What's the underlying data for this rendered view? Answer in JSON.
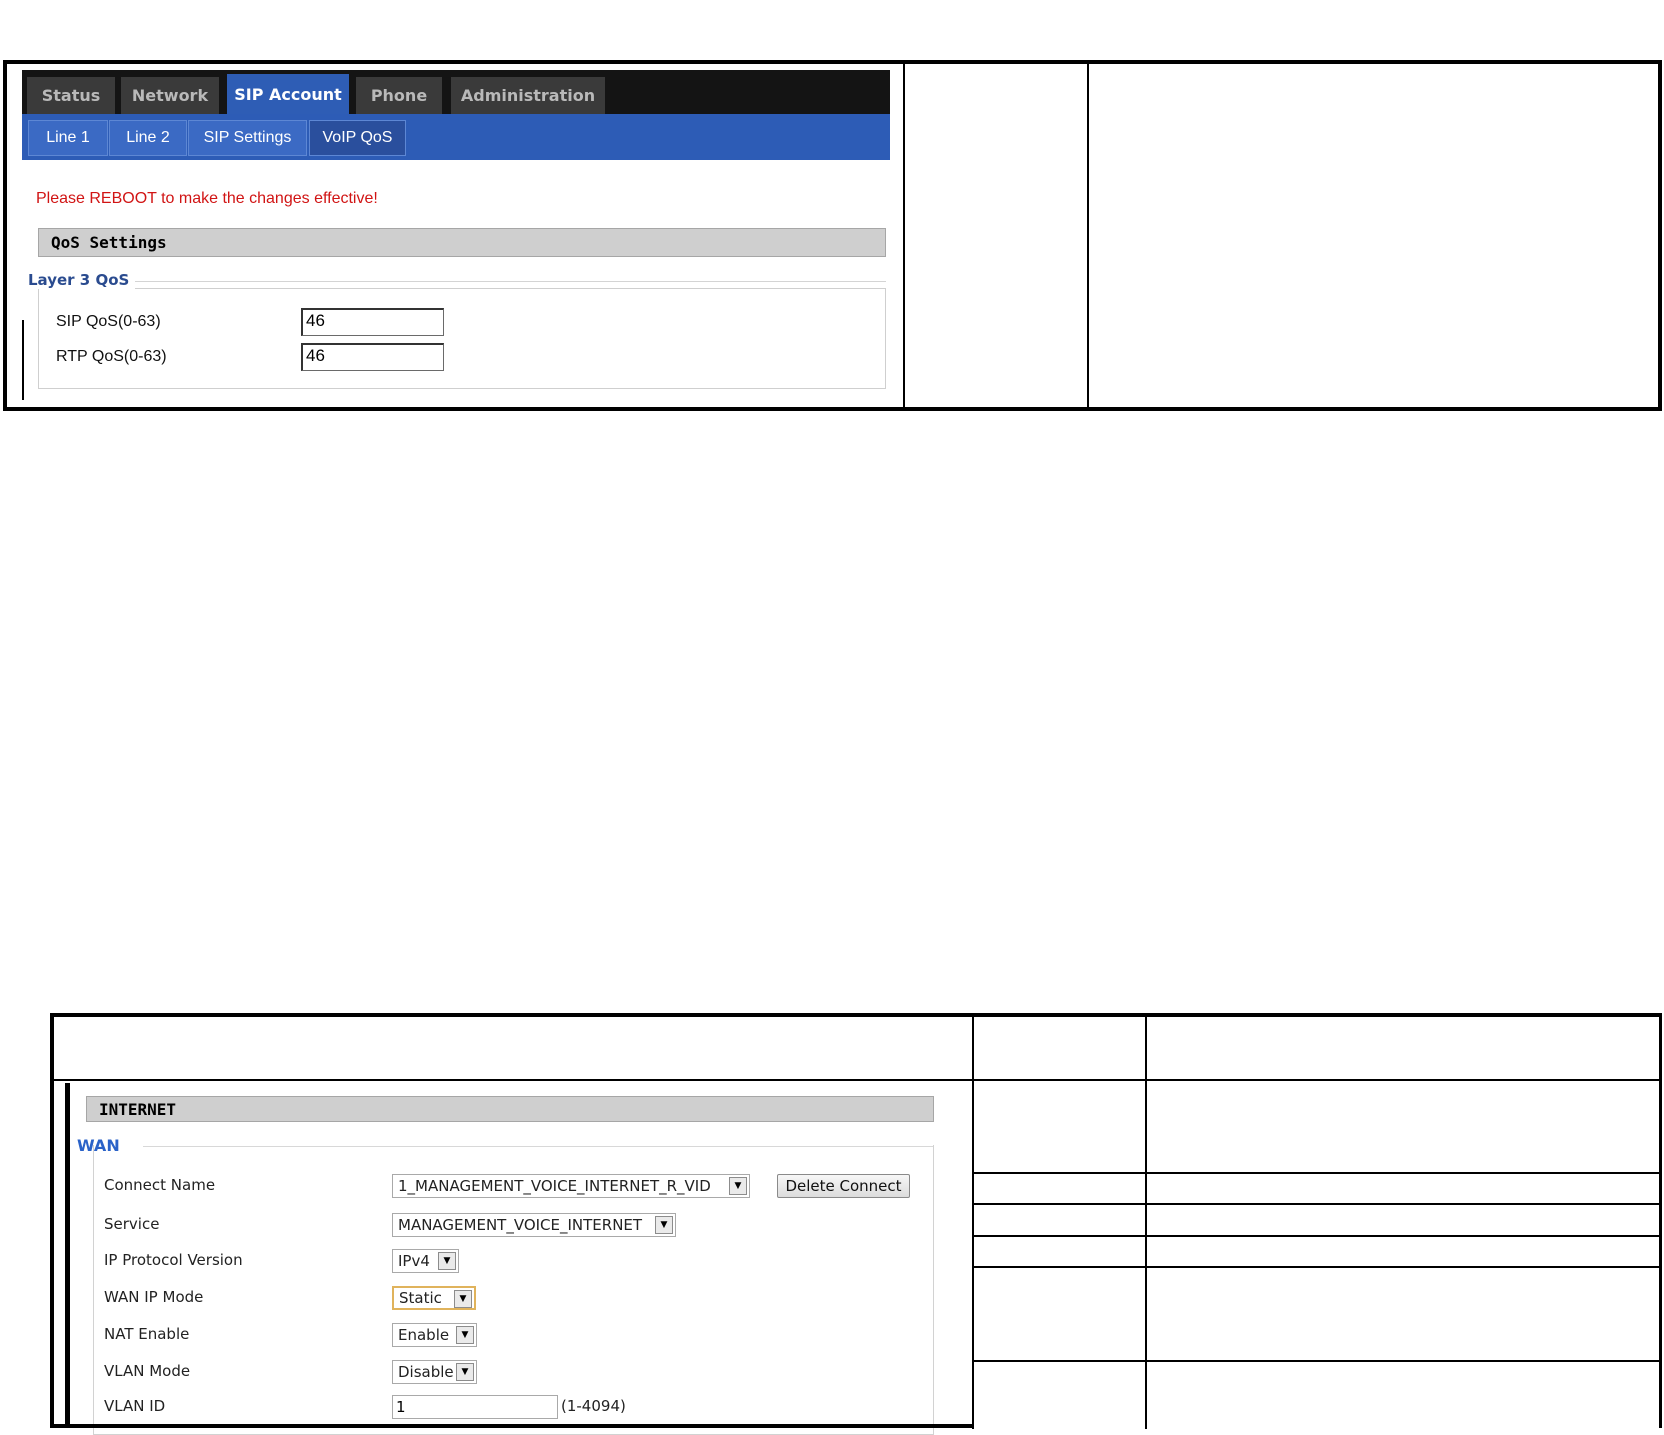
{
  "top_ui": {
    "tabs": [
      {
        "label": "Status"
      },
      {
        "label": "Network"
      },
      {
        "label": "SIP Account",
        "active": true
      },
      {
        "label": "Phone"
      },
      {
        "label": "Administration"
      }
    ],
    "subtabs": [
      {
        "label": "Line 1"
      },
      {
        "label": "Line 2"
      },
      {
        "label": "SIP Settings"
      },
      {
        "label": "VoIP QoS",
        "active": true
      }
    ],
    "warning": "Please REBOOT to make the changes effective!",
    "section_title": "QoS Settings",
    "group_title": "Layer 3 QoS",
    "fields": [
      {
        "label": "SIP QoS(0-63)",
        "value": "46"
      },
      {
        "label": "RTP QoS(0-63)",
        "value": "46"
      }
    ]
  },
  "bottom_ui": {
    "section_title": "INTERNET",
    "group_title": "WAN",
    "connect_name": {
      "label": "Connect Name",
      "value": "1_MANAGEMENT_VOICE_INTERNET_R_VID"
    },
    "delete_button": "Delete Connect",
    "service": {
      "label": "Service",
      "value": "MANAGEMENT_VOICE_INTERNET"
    },
    "ip_protocol": {
      "label": "IP Protocol Version",
      "value": "IPv4"
    },
    "wan_ip_mode": {
      "label": "WAN IP Mode",
      "value": "Static"
    },
    "nat_enable": {
      "label": "NAT Enable",
      "value": "Enable"
    },
    "vlan_mode": {
      "label": "VLAN Mode",
      "value": "Disable"
    },
    "vlan_id": {
      "label": "VLAN ID",
      "value": "1",
      "hint": "(1-4094)"
    }
  },
  "colors": {
    "nav_dark": "#141414",
    "tab_active": "#2e5db5",
    "subnav_blue": "#2d5cb6",
    "warning_red": "#d11414",
    "group_title_blue": "#2a4b8f"
  },
  "icons": {
    "select_arrow": "chevron-down-icon"
  }
}
